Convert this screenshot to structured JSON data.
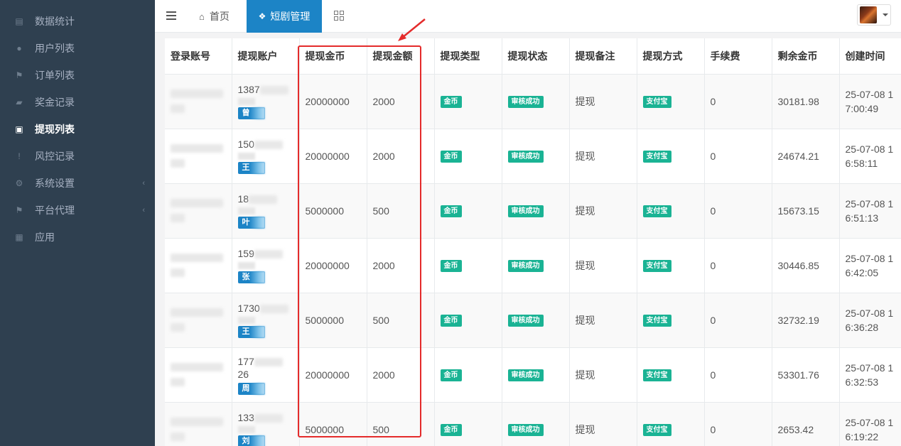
{
  "sidebar": {
    "items": [
      {
        "label": "数据统计",
        "icon": "chart-icon"
      },
      {
        "label": "用户列表",
        "icon": "user-icon"
      },
      {
        "label": "订单列表",
        "icon": "flag-icon"
      },
      {
        "label": "奖金记录",
        "icon": "book-icon"
      },
      {
        "label": "提现列表",
        "icon": "briefcase-icon",
        "active": true
      },
      {
        "label": "风控记录",
        "icon": "exclamation-icon"
      },
      {
        "label": "系统设置",
        "icon": "gear-icon",
        "has_children": true
      },
      {
        "label": "平台代理",
        "icon": "flag-icon",
        "has_children": true
      },
      {
        "label": "应用",
        "icon": "apps-icon"
      }
    ]
  },
  "topbar": {
    "tabs": [
      {
        "label": "首页",
        "icon": "home-icon"
      },
      {
        "label": "短剧管理",
        "icon": "dropbox-icon",
        "active": true
      }
    ]
  },
  "table": {
    "headers": [
      "登录账号",
      "提现账户",
      "提现金币",
      "提现金额",
      "提现类型",
      "提现状态",
      "提现备注",
      "提现方式",
      "手续费",
      "剩余金币",
      "创建时间"
    ],
    "rows": [
      {
        "acct_prefix": "1387",
        "acct_suffix": "",
        "name_char": "曾",
        "coins": "20000000",
        "amount": "2000",
        "type": "金币",
        "status": "审核成功",
        "remark": "提现",
        "method": "支付宝",
        "fee": "0",
        "balance": "30181.98",
        "created": "25-07-08 17:00:49"
      },
      {
        "acct_prefix": "150",
        "acct_suffix": "",
        "name_char": "王",
        "coins": "20000000",
        "amount": "2000",
        "type": "金币",
        "status": "审核成功",
        "remark": "提现",
        "method": "支付宝",
        "fee": "0",
        "balance": "24674.21",
        "created": "25-07-08 16:58:11"
      },
      {
        "acct_prefix": "18",
        "acct_suffix": "",
        "name_char": "叶",
        "coins": "5000000",
        "amount": "500",
        "type": "金币",
        "status": "审核成功",
        "remark": "提现",
        "method": "支付宝",
        "fee": "0",
        "balance": "15673.15",
        "created": "25-07-08 16:51:13"
      },
      {
        "acct_prefix": "159",
        "acct_suffix": "",
        "name_char": "张",
        "coins": "20000000",
        "amount": "2000",
        "type": "金币",
        "status": "审核成功",
        "remark": "提现",
        "method": "支付宝",
        "fee": "0",
        "balance": "30446.85",
        "created": "25-07-08 16:42:05"
      },
      {
        "acct_prefix": "1730",
        "acct_suffix": "",
        "name_char": "王",
        "coins": "5000000",
        "amount": "500",
        "type": "金币",
        "status": "审核成功",
        "remark": "提现",
        "method": "支付宝",
        "fee": "0",
        "balance": "32732.19",
        "created": "25-07-08 16:36:28"
      },
      {
        "acct_prefix": "177",
        "acct_suffix": "26",
        "name_char": "周",
        "coins": "20000000",
        "amount": "2000",
        "type": "金币",
        "status": "审核成功",
        "remark": "提现",
        "method": "支付宝",
        "fee": "0",
        "balance": "53301.76",
        "created": "25-07-08 16:32:53"
      },
      {
        "acct_prefix": "133",
        "acct_suffix": "",
        "name_char": "刘",
        "coins": "5000000",
        "amount": "500",
        "type": "金币",
        "status": "审核成功",
        "remark": "提现",
        "method": "支付宝",
        "fee": "0",
        "balance": "2653.42",
        "created": "25-07-08 16:19:22"
      }
    ]
  },
  "colors": {
    "sidebar_bg": "#2f4050",
    "active_tab": "#1c84c6",
    "label_green": "#1ab394",
    "annotation_red": "#e42b2b"
  }
}
